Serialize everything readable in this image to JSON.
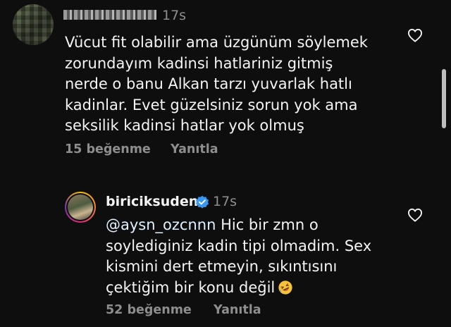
{
  "comments": [
    {
      "time": "17s",
      "text": "Vücut fit olabilir ama üzgünüm söylemek\nzorundayım kadinsi hatlariniz gitmiş\nnerde o banu Alkan tarzı yuvarlak hatlı\nkadinlar. Evet güzelsiniz sorun yok ama\nseksilik kadinsi hatlar yok olmuş",
      "likes": "15 beğenme",
      "reply": "Yanıtla",
      "icons": {
        "avatar": "blurred-avatar",
        "like": "heart-outline-icon"
      }
    },
    {
      "username": "biriciksuden",
      "time": "17s",
      "mention": "@aysn_ozcnnn",
      "text": " Hic bir zmn o\nsoylediginiz kadin tipi olmadim. Sex\nkismini dert etmeyin, sıkıntısını\nçektiğim bir konu değil",
      "likes": "52 beğenme",
      "reply": "Yanıtla",
      "icons": {
        "verified": "verified-badge-icon",
        "emoji": "rolling-laughing-emoji",
        "like": "heart-outline-icon"
      }
    }
  ],
  "colors": {
    "background": "#0e0e0e",
    "text": "#f5f5f5",
    "muted": "#8e8e8e",
    "verified": "#3897f0"
  }
}
